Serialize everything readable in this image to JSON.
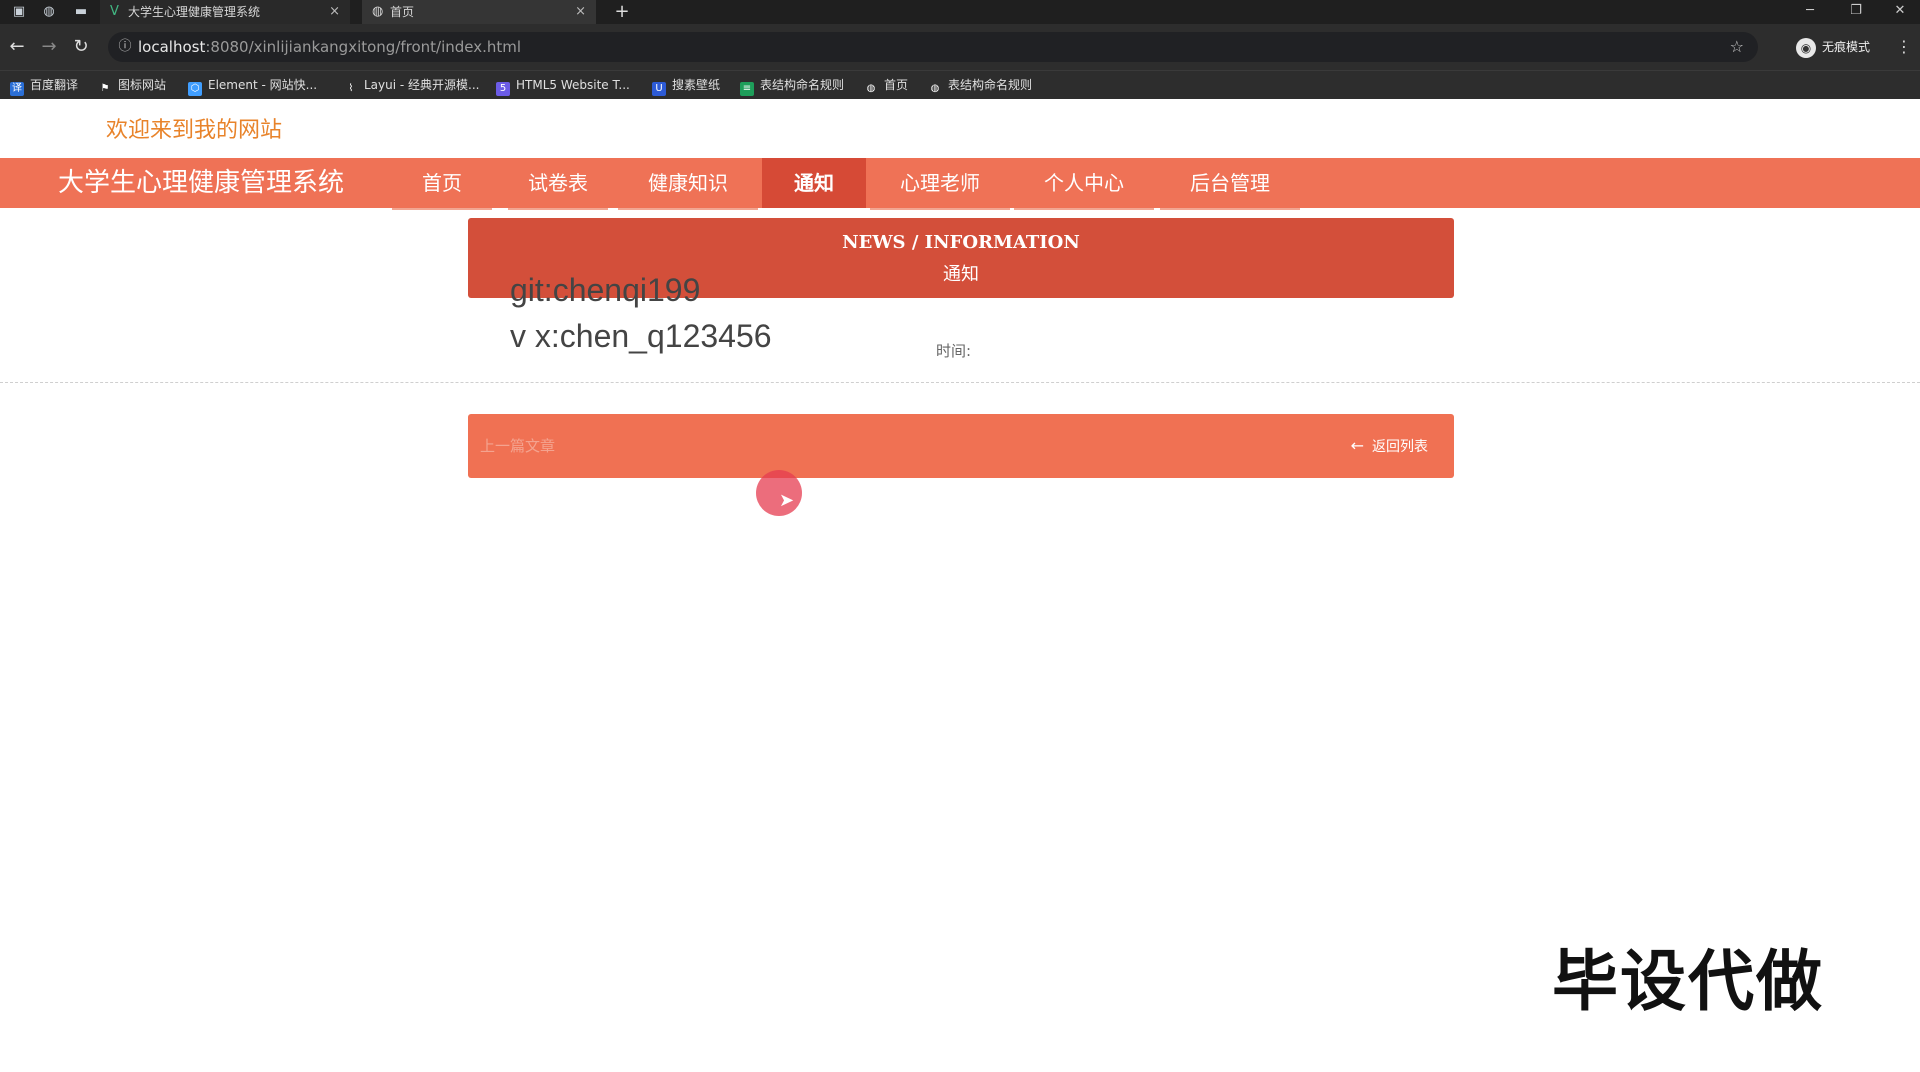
{
  "browser": {
    "tabs": [
      {
        "title": "大学生心理健康管理系统",
        "icon": "vue-icon",
        "close": "×"
      },
      {
        "title": "首页",
        "icon": "globe-icon",
        "close": "×"
      }
    ],
    "new_tab": "+",
    "window_controls": {
      "minimize": "─",
      "restore": "❐",
      "close": "✕"
    },
    "url_host": "localhost",
    "url_rest": ":8080/xinlijiankangxitong/front/index.html",
    "profile_label": "无痕模式",
    "bookmarks": [
      {
        "label": "百度翻译",
        "icon": "translate-icon",
        "color": "#2b6fd6"
      },
      {
        "label": "图标网站",
        "icon": "flag-icon",
        "color": "#444444"
      },
      {
        "label": "Element - 网站快...",
        "icon": "element-icon",
        "color": "#409eff"
      },
      {
        "label": "Layui - 经典开源模...",
        "icon": "layui-icon",
        "color": "#555555"
      },
      {
        "label": "HTML5 Website T...",
        "icon": "html5-icon",
        "color": "#6c5ce7"
      },
      {
        "label": "搜素壁纸",
        "icon": "wallpaper-icon",
        "color": "#2d5bd6"
      },
      {
        "label": "表结构命名规则",
        "icon": "sheet-icon",
        "color": "#1e9e5a"
      },
      {
        "label": "首页",
        "icon": "globe-icon",
        "color": "#444444"
      },
      {
        "label": "表结构命名规则",
        "icon": "globe-icon",
        "color": "#444444"
      }
    ]
  },
  "site": {
    "welcome": "欢迎来到我的网站",
    "brand": "大学生心理健康管理系统",
    "nav": [
      {
        "label": "首页",
        "active": false
      },
      {
        "label": "试卷表",
        "active": false
      },
      {
        "label": "健康知识",
        "active": false
      },
      {
        "label": "通知",
        "active": true
      },
      {
        "label": "心理老师",
        "active": false
      },
      {
        "label": "个人中心",
        "active": false
      },
      {
        "label": "后台管理",
        "active": false
      }
    ],
    "accent_color": "#ef7256",
    "active_color": "#d64a36"
  },
  "banner": {
    "title_en": "NEWS / INFORMATION",
    "title_cn": "通知"
  },
  "overlay": {
    "line1": "git:chenqi199",
    "line2": "v x:chen_q123456"
  },
  "article": {
    "time_label": "时间:"
  },
  "footer_bar": {
    "prev_label": "上一篇文章",
    "back_label": "返回列表",
    "back_icon": "arrow-left-icon"
  },
  "watermark": "毕设代做"
}
